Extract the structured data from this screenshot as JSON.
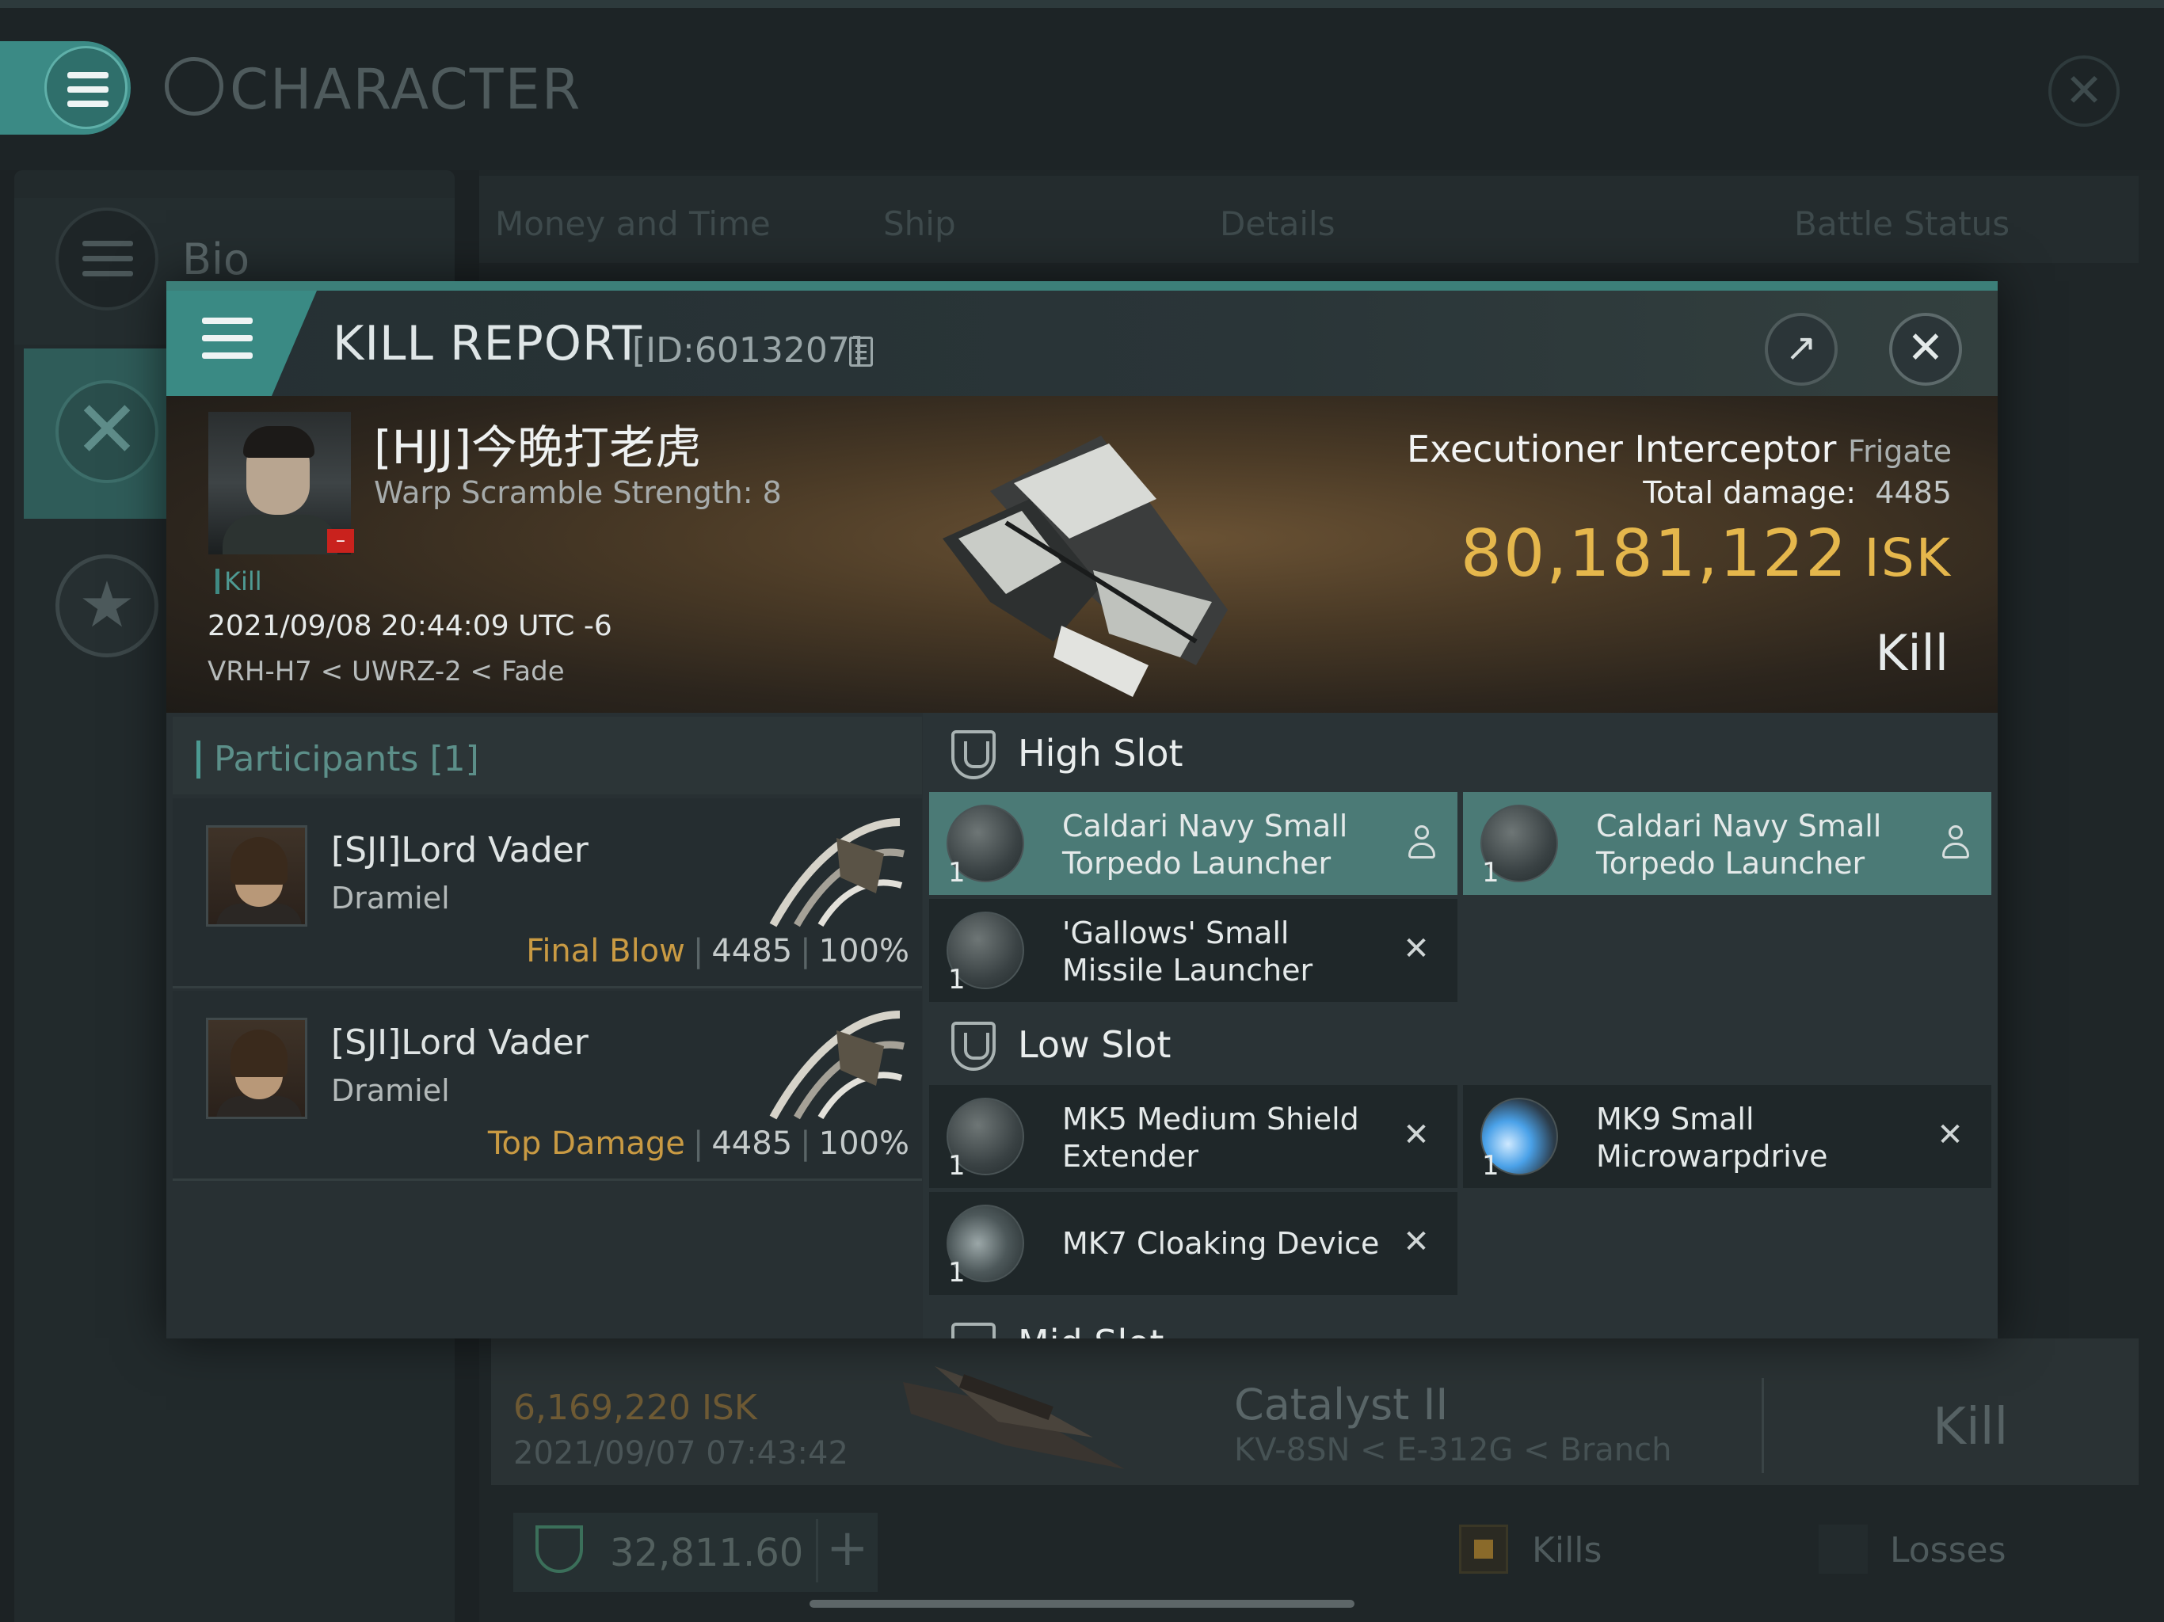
{
  "background": {
    "screen_title": "CHARACTER",
    "sidebar": {
      "bio_label": "Bio"
    },
    "tabs": [
      "Money and Time",
      "Ship",
      "Details",
      "Battle Status"
    ],
    "card": {
      "isk": "6,169,220",
      "isk_unit": "ISK",
      "date": "2021/09/07  07:43:42",
      "ship": "Catalyst II",
      "location": "KV-8SN < E-312G < Branch",
      "result": "Kill"
    },
    "balance": "32,811.60",
    "kills_label": "Kills",
    "losses_label": "Losses"
  },
  "report": {
    "title": "KILL REPORT",
    "id": "[ID:6013207]",
    "victim": {
      "name": "[HJJ]今晚打老虎",
      "warp": "Warp Scramble Strength: 8",
      "tag": "Kill",
      "time": "2021/09/08 20:44:09 UTC -6",
      "location": "VRH-H7 < UWRZ-2 < Fade"
    },
    "ship": {
      "name": "Executioner Interceptor",
      "class": "Frigate",
      "damage_label": "Total damage:",
      "damage": "4485",
      "isk": "80,181,122",
      "isk_unit": "ISK",
      "result": "Kill"
    },
    "participants": {
      "title": "Participants [1]",
      "rows": [
        {
          "name": "[SJI]Lord Vader",
          "ship": "Dramiel",
          "label": "Final Blow",
          "damage": "4485",
          "percent": "100%"
        },
        {
          "name": "[SJI]Lord Vader",
          "ship": "Dramiel",
          "label": "Top Damage",
          "damage": "4485",
          "percent": "100%"
        }
      ]
    },
    "fitting": {
      "high_title": "High Slot",
      "high": [
        {
          "name": "Caldari Navy Small Torpedo Launcher",
          "qty": "1",
          "status": "destroyed-person"
        },
        {
          "name": "Caldari Navy Small Torpedo Launcher",
          "qty": "1",
          "status": "destroyed-person"
        },
        {
          "name": "'Gallows' Small Missile Launcher",
          "qty": "1",
          "status": "x"
        }
      ],
      "low_title": "Low Slot",
      "low": [
        {
          "name": "MK5 Medium Shield Extender",
          "qty": "1",
          "status": "x"
        },
        {
          "name": "MK9 Small Microwarpdrive",
          "qty": "1",
          "status": "x"
        },
        {
          "name": "MK7 Cloaking Device",
          "qty": "1",
          "status": "x"
        }
      ],
      "mid_title": "Mid Slot"
    }
  },
  "colors": {
    "accent": "#3a8a84",
    "isk_gold": "#e5b74c",
    "label_gold": "#c99a43",
    "highlight_row": "#4b7a76"
  }
}
